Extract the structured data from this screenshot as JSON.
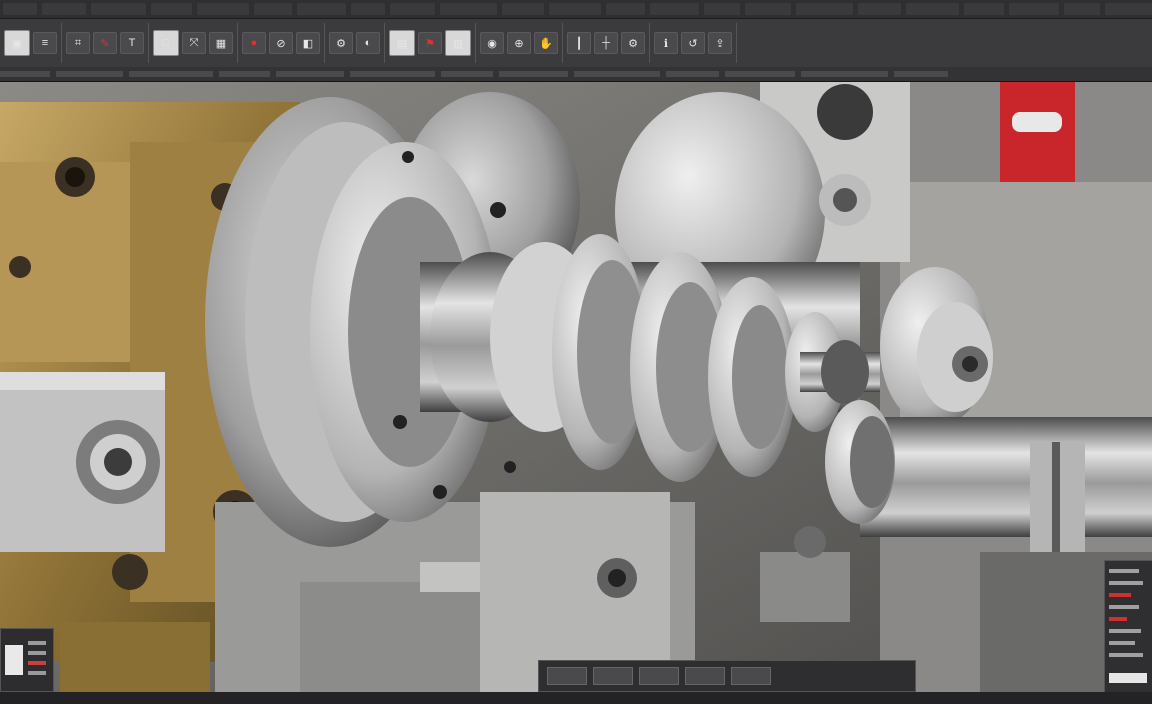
{
  "menubar": {
    "items": [
      "",
      "",
      "",
      "",
      "",
      "",
      "",
      "",
      "",
      "",
      "",
      "",
      "",
      "",
      "",
      "",
      "",
      "",
      "",
      "",
      "",
      "",
      ""
    ]
  },
  "toolbar": {
    "groups": [
      {
        "icon": "image-icon"
      },
      {
        "icon": "layers-icon"
      },
      {
        "icon": "crop-icon"
      },
      {
        "icon": "brush-icon"
      },
      {
        "icon": "text-icon"
      },
      {
        "icon": "shape-icon"
      },
      {
        "icon": "transform-icon"
      },
      {
        "icon": "color-icon"
      },
      {
        "icon": "filter-icon"
      },
      {
        "icon": "view-icon"
      }
    ]
  },
  "statusline": {
    "items": [
      "",
      "",
      "",
      "",
      "",
      "",
      "",
      "",
      "",
      "",
      "",
      "",
      ""
    ]
  },
  "panels": {
    "bottom": {
      "buttons": [
        "",
        "",
        "",
        "",
        ""
      ]
    }
  },
  "colors": {
    "chrome_dark": "#2f2f31",
    "chrome_mid": "#3b3b3d",
    "accent_red": "#d0302f",
    "brass": "#a8894a",
    "steel": "#b9b9b9"
  }
}
